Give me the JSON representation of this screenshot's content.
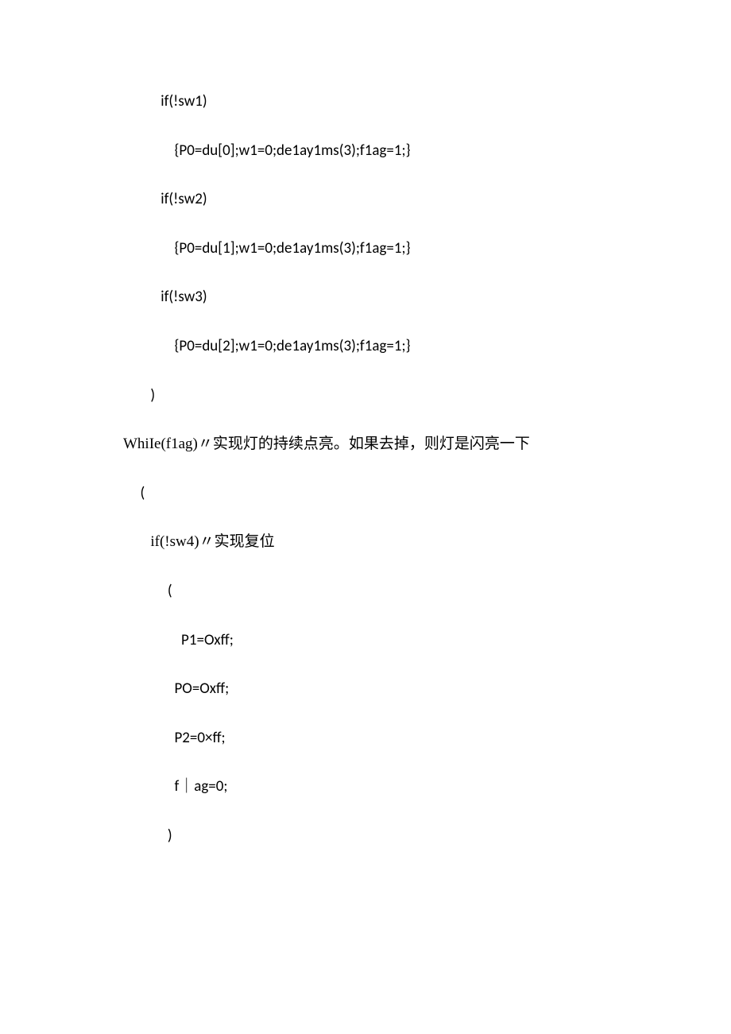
{
  "lines": [
    {
      "indent": "           ",
      "text": "if(!sw1)"
    },
    {
      "indent": "               ",
      "text": "{P0=du[0];w1=0;de1ay1ms(3);f1ag=1;}"
    },
    {
      "indent": "           ",
      "text": "if(!sw2)"
    },
    {
      "indent": "               ",
      "text": "{P0=du[1];w1=0;de1ay1ms(3);f1ag=1;}"
    },
    {
      "indent": "           ",
      "text": "if(!sw3)"
    },
    {
      "indent": "               ",
      "text": "{P0=du[2];w1=0;de1ay1ms(3);f1ag=1;}"
    },
    {
      "indent": "        ",
      "text": ")"
    },
    {
      "indent": "",
      "text": "WhiIe(f1ag)〃实现灯的持续点亮。如果去掉，则灯是闪亮一下"
    },
    {
      "indent": "     ",
      "text": "("
    },
    {
      "indent": "        ",
      "text": "if(!sw4)〃实现复位"
    },
    {
      "indent": "             ",
      "text": "("
    },
    {
      "indent": "                 ",
      "text": "P1=Oxff;"
    },
    {
      "indent": "               ",
      "text": "PO=Oxff;"
    },
    {
      "indent": "               ",
      "text": "P2=0×ff;"
    },
    {
      "indent": "               ",
      "text": "f｜ag=0;"
    },
    {
      "indent": "             ",
      "text": ")"
    }
  ]
}
